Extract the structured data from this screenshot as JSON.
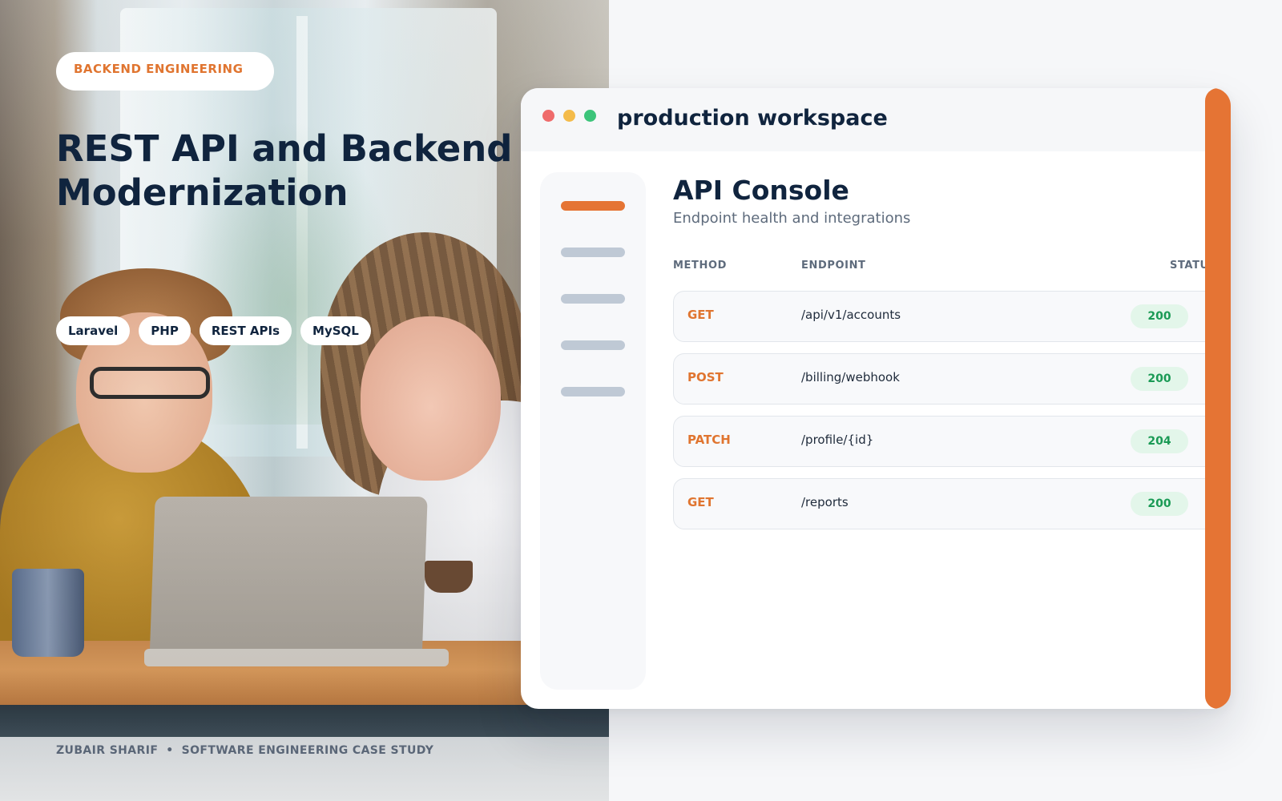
{
  "hero": {
    "badge": "BACKEND ENGINEERING",
    "title_line1": "REST API and Backend",
    "title_line2": "Modernization",
    "tags": [
      "Laravel",
      "PHP",
      "REST APIs",
      "MySQL"
    ],
    "footer_author": "ZUBAIR SHARIF",
    "footer_separator": "•",
    "footer_label": "SOFTWARE ENGINEERING CASE STUDY"
  },
  "window": {
    "title": "production workspace",
    "accent_color": "#e57434",
    "sidebar_items": 5,
    "active_sidebar_index": 0
  },
  "console": {
    "title": "API Console",
    "subtitle": "Endpoint health and integrations",
    "columns": {
      "method": "METHOD",
      "endpoint": "ENDPOINT",
      "status": "STATU"
    },
    "rows": [
      {
        "method": "GET",
        "endpoint": "/api/v1/accounts",
        "status": "200"
      },
      {
        "method": "POST",
        "endpoint": "/billing/webhook",
        "status": "200"
      },
      {
        "method": "PATCH",
        "endpoint": "/profile/{id}",
        "status": "204"
      },
      {
        "method": "GET",
        "endpoint": "/reports",
        "status": "200"
      }
    ]
  },
  "colors": {
    "navy": "#10243e",
    "orange": "#e07530",
    "success_text": "#1a9a55",
    "success_bg": "#e3f6ea"
  }
}
